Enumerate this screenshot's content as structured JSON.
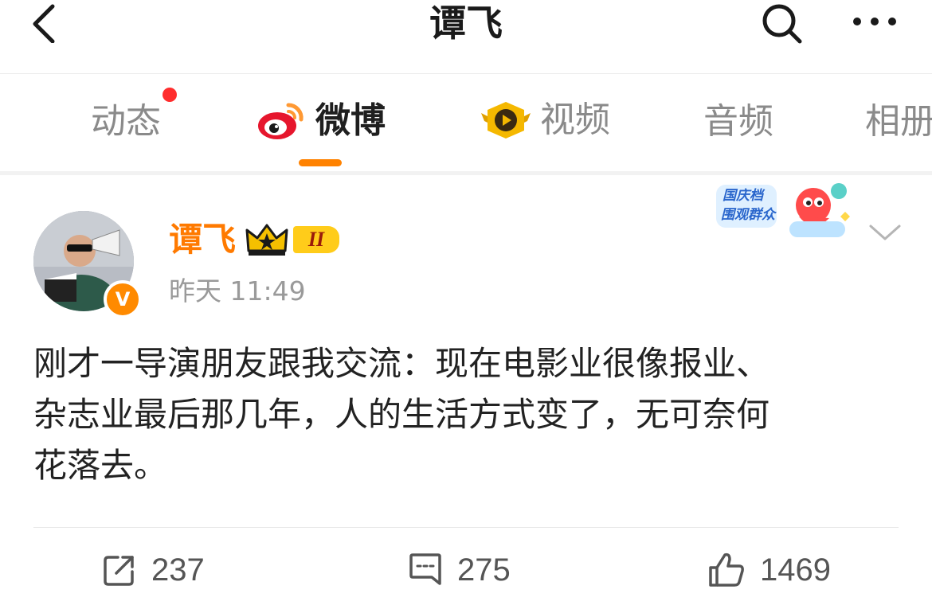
{
  "header": {
    "title": "谭飞",
    "back_icon": "chevron-left-icon",
    "search_icon": "search-icon",
    "more_icon": "more-dots-icon"
  },
  "tabs": [
    {
      "label": "动态",
      "active": false,
      "has_dot": true
    },
    {
      "label": "微博",
      "active": true,
      "icon": "weibo-logo-icon"
    },
    {
      "label": "视频",
      "active": false,
      "icon": "video-play-icon"
    },
    {
      "label": "音频",
      "active": false
    },
    {
      "label": "相册",
      "active": false
    }
  ],
  "post": {
    "author": "谭飞",
    "crown_badge_icon": "crown-icon",
    "level_badge": "II",
    "verified_badge": "V",
    "time": "昨天 11:49",
    "sticker": {
      "line1": "国庆档",
      "line2": "围观群众"
    },
    "text_lines": [
      "刚才一导演朋友跟我交流：现在电影业很像报业、",
      "杂志业最后那几年，人的生活方式变了，无可奈何",
      "花落去。"
    ]
  },
  "actions": {
    "repost": {
      "icon": "share-icon",
      "count": "237"
    },
    "comment": {
      "icon": "comment-icon",
      "count": "275"
    },
    "like": {
      "icon": "thumbs-up-icon",
      "count": "1469"
    }
  },
  "colors": {
    "accent": "#ff8200",
    "username": "#ff7a00",
    "dot": "#ff2d2d",
    "muted": "#9a9a9a"
  }
}
